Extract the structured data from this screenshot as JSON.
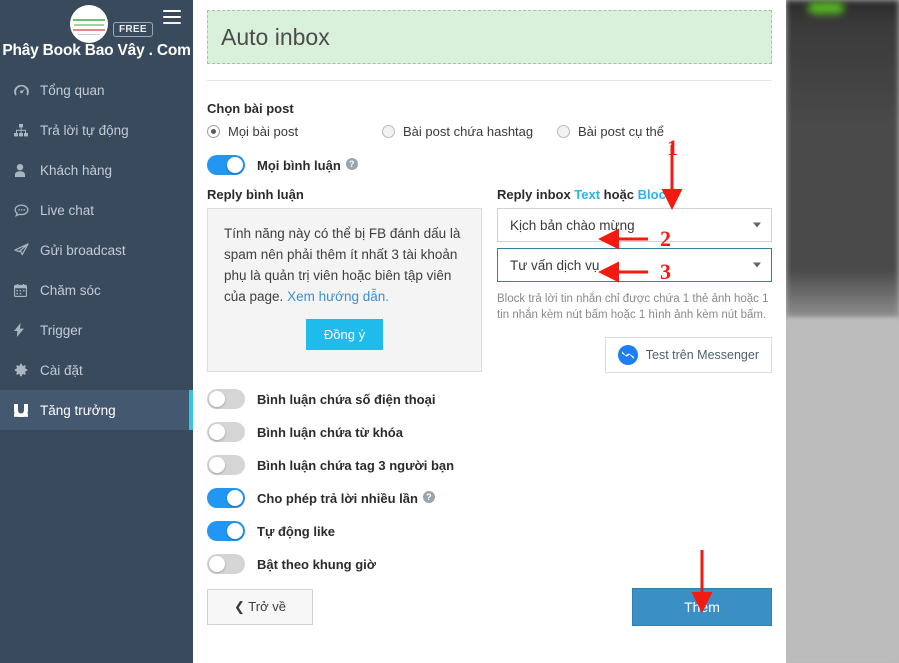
{
  "sidebar": {
    "brand": "Phây Book Bao Vây . Com",
    "badge": "FREE",
    "logo_icon": "circular-logo-icon",
    "menu_icon": "hamburger-menu-icon",
    "items": [
      {
        "label": "Tổng quan",
        "icon": "dashboard-icon",
        "glyph": "◍",
        "active": false
      },
      {
        "label": "Trả lời tự động",
        "icon": "sitemap-icon",
        "glyph": "⚏",
        "active": false
      },
      {
        "label": "Khách hàng",
        "icon": "user-icon",
        "glyph": "👤",
        "active": false
      },
      {
        "label": "Live chat",
        "icon": "comment-icon",
        "glyph": "💬",
        "active": false
      },
      {
        "label": "Gửi broadcast",
        "icon": "paper-plane-icon",
        "glyph": "➤",
        "active": false
      },
      {
        "label": "Chăm sóc",
        "icon": "calendar-icon",
        "glyph": "▦",
        "active": false
      },
      {
        "label": "Trigger",
        "icon": "bolt-icon",
        "glyph": "⚡",
        "active": false
      },
      {
        "label": "Cài đặt",
        "icon": "gear-icon",
        "glyph": "✿",
        "active": false
      },
      {
        "label": "Tăng trưởng",
        "icon": "magnet-icon",
        "glyph": "∪",
        "active": true
      }
    ]
  },
  "main": {
    "banner_title": "Auto inbox",
    "post_section_label": "Chọn bài post",
    "post_options": [
      {
        "label": "Mọi bài post",
        "checked": true
      },
      {
        "label": "Bài post chứa hashtag",
        "checked": false
      },
      {
        "label": "Bài post cụ thể",
        "checked": false
      }
    ],
    "all_comments_toggle": {
      "label": "Mọi bình luận",
      "on": true,
      "help_icon": "question-mark-icon"
    },
    "reply_comment": {
      "label": "Reply bình luận",
      "notice": "Tính năng này có thể bị FB đánh dấu là spam nên phải thêm ít nhất 3 tài khoản phụ là quản trị viên hoặc biên tập viên của page. ",
      "link_text": "Xem hướng dẫn.",
      "agree_button": "Đồng ý"
    },
    "reply_inbox": {
      "label_prefix": "Reply inbox ",
      "label_text_link": "Text",
      "label_middle": " hoặc ",
      "label_block_link": "Block",
      "select_1_value": "Kịch bản chào mừng",
      "select_2_value": "Tư vấn dịch vụ",
      "hint": "Block trả lời tin nhắn chỉ được chứa 1 thẻ ảnh hoặc 1 tin nhắn kèm nút bấm hoặc 1 hình ảnh kèm nút bấm.",
      "messenger_button": "Test trên Messenger",
      "messenger_icon": "messenger-icon"
    },
    "toggles": [
      {
        "label": "Bình luận chứa số điện thoại",
        "on": false,
        "help": false
      },
      {
        "label": "Bình luận chứa từ khóa",
        "on": false,
        "help": false
      },
      {
        "label": "Bình luận chứa tag 3 người bạn",
        "on": false,
        "help": false
      },
      {
        "label": "Cho phép trả lời nhiều lần",
        "on": true,
        "help": true
      },
      {
        "label": "Tự động like",
        "on": true,
        "help": false
      },
      {
        "label": "Bật theo khung giờ",
        "on": false,
        "help": false
      }
    ],
    "footer": {
      "back_button": "Trở về",
      "back_icon": "chevron-left-icon",
      "add_button": "Thêm"
    }
  },
  "annotations": [
    {
      "number": "1",
      "icon": "red-arrow-down-icon"
    },
    {
      "number": "2",
      "icon": "red-arrow-left-icon"
    },
    {
      "number": "3",
      "icon": "red-arrow-left-icon"
    },
    {
      "number": "",
      "icon": "red-arrow-down-icon"
    }
  ],
  "colors": {
    "sidebar_bg": "#3a4a5d",
    "sidebar_active": "#44586f",
    "accent_cyan": "#33c6dd",
    "toggle_on": "#2196f3",
    "banner_bg": "#d9f0da",
    "primary_button": "#3a8fc4",
    "agree_button": "#1fbceb",
    "annotation_red": "#f21b12",
    "link_blue": "#2bb3e8"
  }
}
